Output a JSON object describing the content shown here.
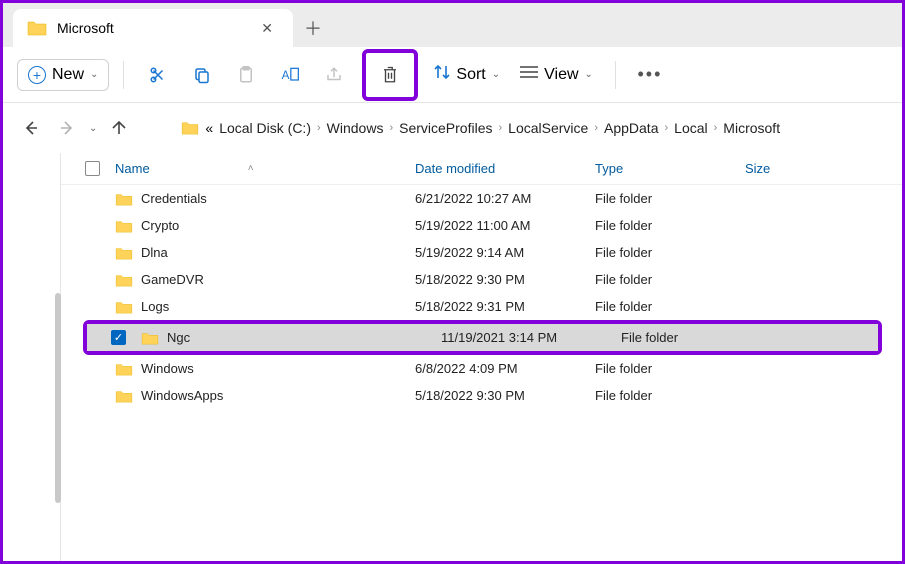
{
  "tab": {
    "title": "Microsoft"
  },
  "toolbar": {
    "new_label": "New",
    "sort_label": "Sort",
    "view_label": "View"
  },
  "breadcrumb": {
    "overflow": "«",
    "items": [
      "Local Disk (C:)",
      "Windows",
      "ServiceProfiles",
      "LocalService",
      "AppData",
      "Local",
      "Microsoft"
    ]
  },
  "columns": {
    "name": "Name",
    "date": "Date modified",
    "type": "Type",
    "size": "Size"
  },
  "rows": [
    {
      "name": "Credentials",
      "date": "6/21/2022 10:27 AM",
      "type": "File folder",
      "selected": false
    },
    {
      "name": "Crypto",
      "date": "5/19/2022 11:00 AM",
      "type": "File folder",
      "selected": false
    },
    {
      "name": "Dlna",
      "date": "5/19/2022 9:14 AM",
      "type": "File folder",
      "selected": false
    },
    {
      "name": "GameDVR",
      "date": "5/18/2022 9:30 PM",
      "type": "File folder",
      "selected": false
    },
    {
      "name": "Logs",
      "date": "5/18/2022 9:31 PM",
      "type": "File folder",
      "selected": false
    },
    {
      "name": "Ngc",
      "date": "11/19/2021 3:14 PM",
      "type": "File folder",
      "selected": true
    },
    {
      "name": "Windows",
      "date": "6/8/2022 4:09 PM",
      "type": "File folder",
      "selected": false
    },
    {
      "name": "WindowsApps",
      "date": "5/18/2022 9:30 PM",
      "type": "File folder",
      "selected": false
    }
  ]
}
